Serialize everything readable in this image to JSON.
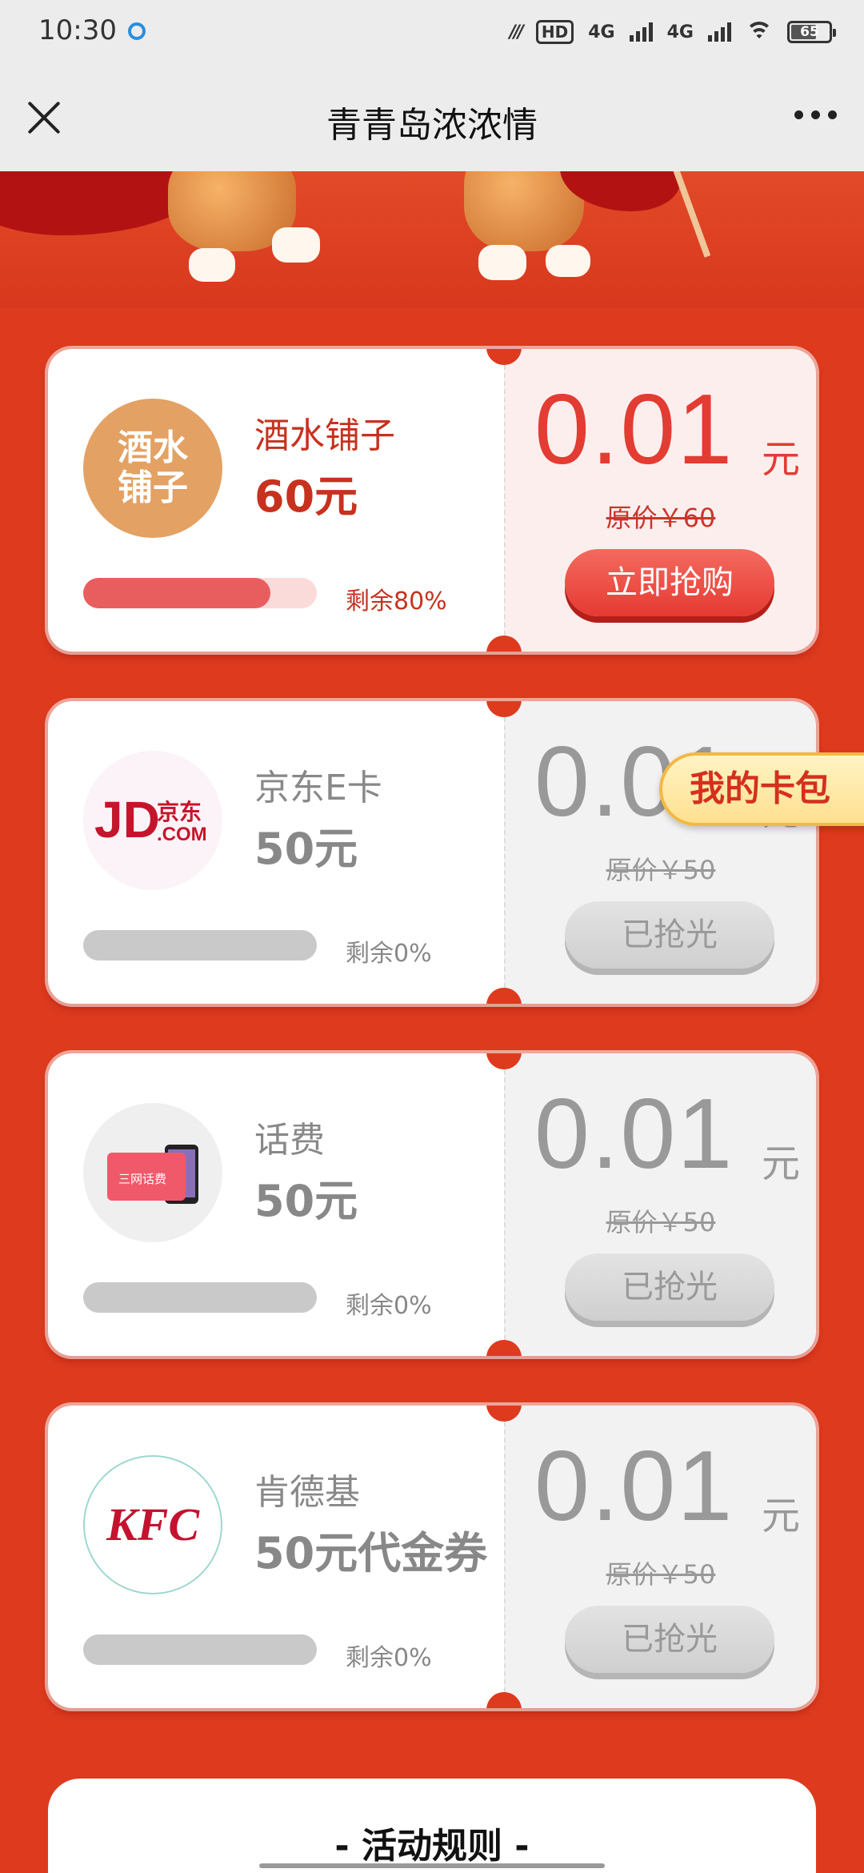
{
  "status_bar": {
    "time": "10:30",
    "hd_badge": "HD",
    "net1": "4G",
    "net2": "4G",
    "battery": "65"
  },
  "nav": {
    "title": "青青岛浓浓情"
  },
  "cards": [
    {
      "logo_text": "酒水\n铺子",
      "name": "酒水铺子",
      "value": "60元",
      "remaining": "剩余80%",
      "progress": 0.8,
      "price": "0.01",
      "unit": "元",
      "original": "原价￥60",
      "button": "立即抢购",
      "status": "active"
    },
    {
      "logo_text": "JD.COM 京东",
      "name": "京东E卡",
      "value": "50元",
      "remaining": "剩余0%",
      "progress": 0,
      "price": "0.01",
      "unit": "元",
      "original": "原价￥50",
      "button": "已抢光",
      "status": "sold_out"
    },
    {
      "logo_text": "三网话费",
      "name": "话费",
      "value": "50元",
      "remaining": "剩余0%",
      "progress": 0,
      "price": "0.01",
      "unit": "元",
      "original": "原价￥50",
      "button": "已抢光",
      "status": "sold_out"
    },
    {
      "logo_text": "KFC",
      "name": "肯德基",
      "value": "50元代金券",
      "remaining": "剩余0%",
      "progress": 0,
      "price": "0.01",
      "unit": "元",
      "original": "原价￥50",
      "button": "已抢光",
      "status": "sold_out"
    }
  ],
  "wallet_tab": "我的卡包",
  "rules_title": "- 活动规则 -",
  "colors": {
    "background": "#dd3a1e",
    "accent": "#e23c33",
    "soldout": "#999999"
  }
}
